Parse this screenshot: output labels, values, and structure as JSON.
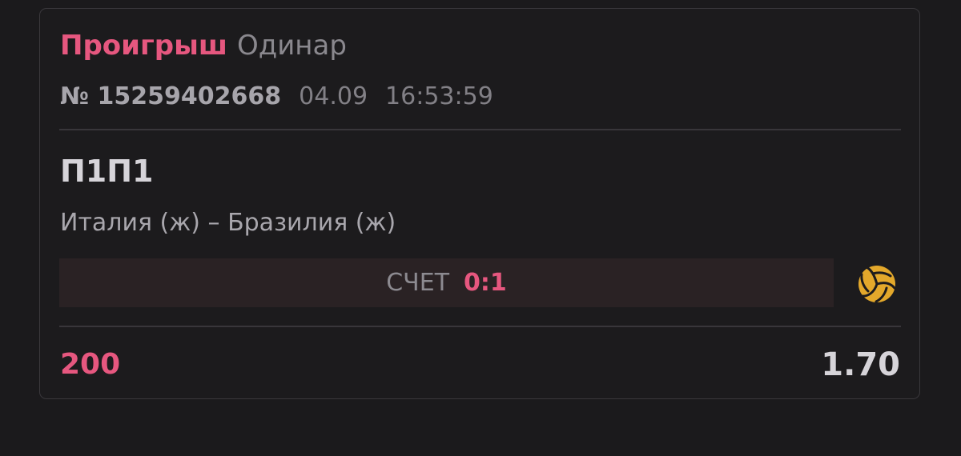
{
  "bet": {
    "status": "Проигрыш",
    "type": "Одинар",
    "ticket_number": "№ 15259402668",
    "date": "04.09",
    "time": "16:53:59",
    "market": "П1П1",
    "match": "Италия (ж) – Бразилия (ж)",
    "score_label": "СЧЕТ",
    "score_value": "0:1",
    "stake": "200",
    "odds": "1.70"
  },
  "icons": {
    "sport": "volleyball-icon"
  },
  "colors": {
    "accent": "#e6577f",
    "background": "#1b1a1c",
    "border": "#3a383c",
    "score_bar": "#2a2224",
    "volleyball": "#e3a82b"
  }
}
